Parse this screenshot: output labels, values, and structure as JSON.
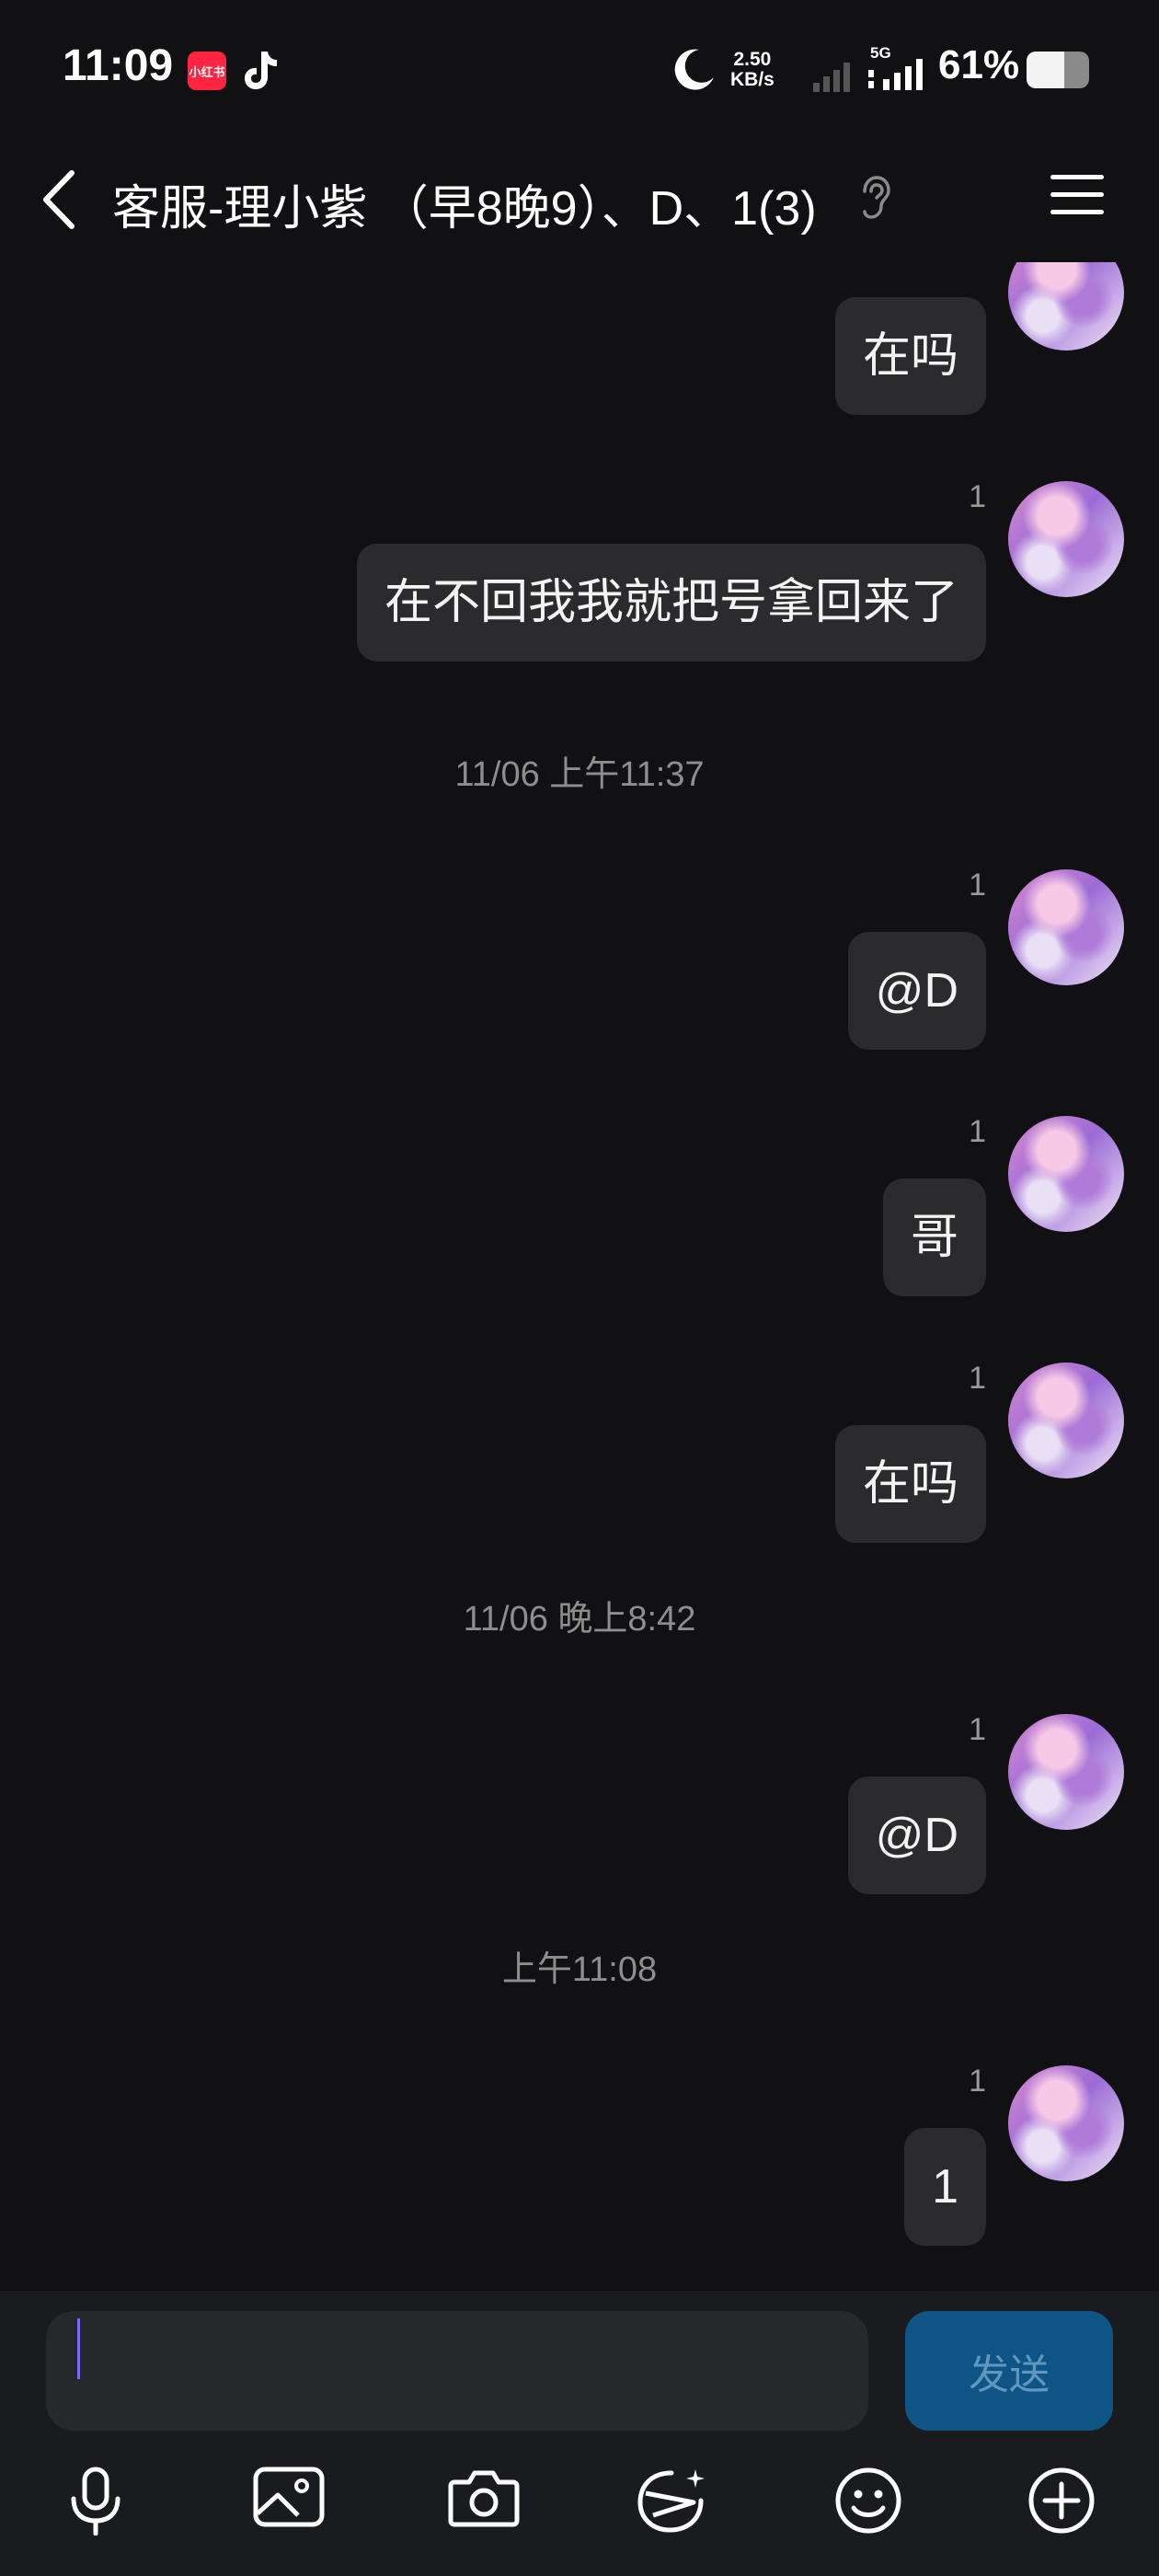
{
  "status_bar": {
    "time": "11:09",
    "app_badge": "小红书",
    "net_speed_value": "2.50",
    "net_speed_unit": "KB/s",
    "network_type": "5G",
    "battery_percent": "61%",
    "battery_level": 0.61
  },
  "header": {
    "title": "客服-理小紫 （早8晚9）、D、1(3)"
  },
  "messages": [
    {
      "type": "message",
      "read": "1",
      "text": "在吗"
    },
    {
      "type": "message",
      "read": "1",
      "text": "在不回我我就把号拿回来了"
    },
    {
      "type": "timestamp",
      "text": "11/06 上午11:37"
    },
    {
      "type": "message",
      "read": "1",
      "text": "@D"
    },
    {
      "type": "message",
      "read": "1",
      "text": "哥"
    },
    {
      "type": "message",
      "read": "1",
      "text": "在吗"
    },
    {
      "type": "timestamp",
      "text": "11/06 晚上8:42"
    },
    {
      "type": "message",
      "read": "1",
      "text": "@D"
    },
    {
      "type": "timestamp",
      "text": "上午11:08"
    },
    {
      "type": "message",
      "read": "1",
      "text": "1"
    }
  ],
  "input": {
    "value": "",
    "send_label": "发送"
  },
  "toolbar_icons": [
    "microphone-icon",
    "image-icon",
    "camera-icon",
    "sticker-icon",
    "emoji-icon",
    "plus-icon"
  ],
  "colors": {
    "background": "#111114",
    "bubble": "#2b2b2d",
    "send_button": "#0e5485",
    "cursor": "#7b6cf6"
  }
}
